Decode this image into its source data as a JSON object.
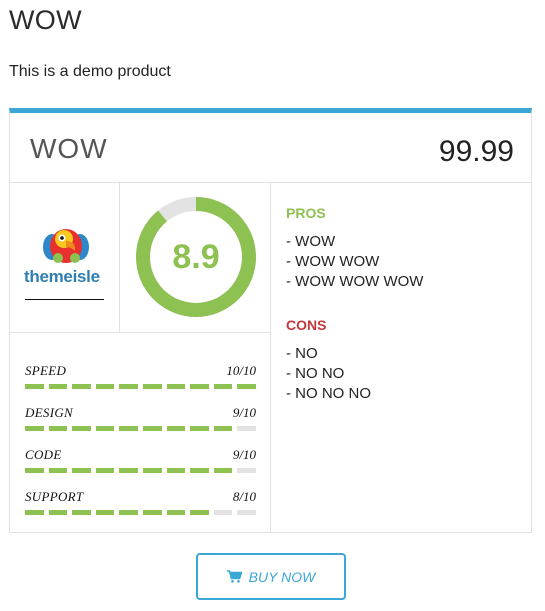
{
  "page": {
    "title": "WOW",
    "description": "This is a demo product"
  },
  "review": {
    "product_name": "WOW",
    "price": "99.99",
    "score": "8.9",
    "score_fraction": 0.89,
    "logo_text": "themeisle",
    "ratings": [
      {
        "label": "SPEED",
        "score": "10/10",
        "value": 10,
        "max": 10
      },
      {
        "label": "DESIGN",
        "score": "9/10",
        "value": 9,
        "max": 10
      },
      {
        "label": "CODE",
        "score": "9/10",
        "value": 9,
        "max": 10
      },
      {
        "label": "SUPPORT",
        "score": "8/10",
        "value": 8,
        "max": 10
      }
    ],
    "pros_heading": "PROS",
    "pros": [
      "- WOW",
      "- WOW WOW",
      "- WOW WOW WOW"
    ],
    "cons_heading": "CONS",
    "cons": [
      "- NO",
      "- NO NO",
      "- NO NO NO"
    ]
  },
  "buy_button": {
    "label": "BUY NOW",
    "icon": "cart-icon"
  },
  "colors": {
    "accent_blue": "#3ba7d6",
    "score_green": "#8dc152",
    "cons_red": "#c0393b",
    "track_gray": "#e3e3e3"
  }
}
